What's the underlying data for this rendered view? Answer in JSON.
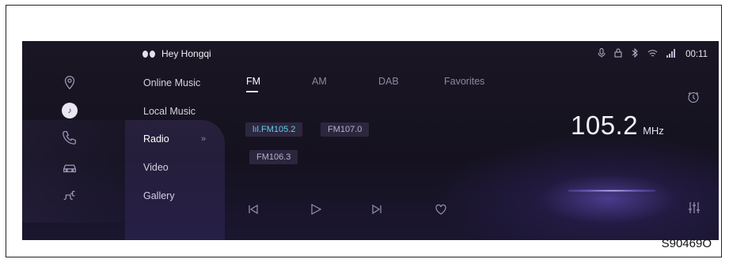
{
  "header": {
    "brand_text": "Hey Hongqi",
    "time": "00:11"
  },
  "status_icons": [
    "mic-icon",
    "lock-icon",
    "bluetooth-icon",
    "wifi-icon",
    "signal-icon"
  ],
  "rail_icons": [
    "navigation-icon",
    "music-icon",
    "phone-icon",
    "car-icon",
    "charging-icon"
  ],
  "menu": {
    "items": [
      {
        "label": "Online Music"
      },
      {
        "label": "Local Music"
      },
      {
        "label": "Radio"
      },
      {
        "label": "Video"
      },
      {
        "label": "Gallery"
      }
    ],
    "active_index": 2,
    "active_chevron": "»"
  },
  "tabs": [
    {
      "label": "FM"
    },
    {
      "label": "AM"
    },
    {
      "label": "DAB"
    },
    {
      "label": "Favorites"
    }
  ],
  "active_tab": "FM",
  "stations": [
    {
      "label": "FM105.2",
      "playing_indicator": "lıl."
    },
    {
      "label": "FM107.0"
    },
    {
      "label": "FM106.3"
    }
  ],
  "frequency": {
    "value": "105.2",
    "unit": "MHz"
  },
  "controls": [
    "previous-icon",
    "play-icon",
    "next-icon",
    "favorite-icon",
    "equalizer-icon"
  ],
  "caption": "S90469O",
  "colors": {
    "screen_bg": "#161321",
    "active_station": "#5fd0e6",
    "accent_glow": "#6f5ce0"
  }
}
